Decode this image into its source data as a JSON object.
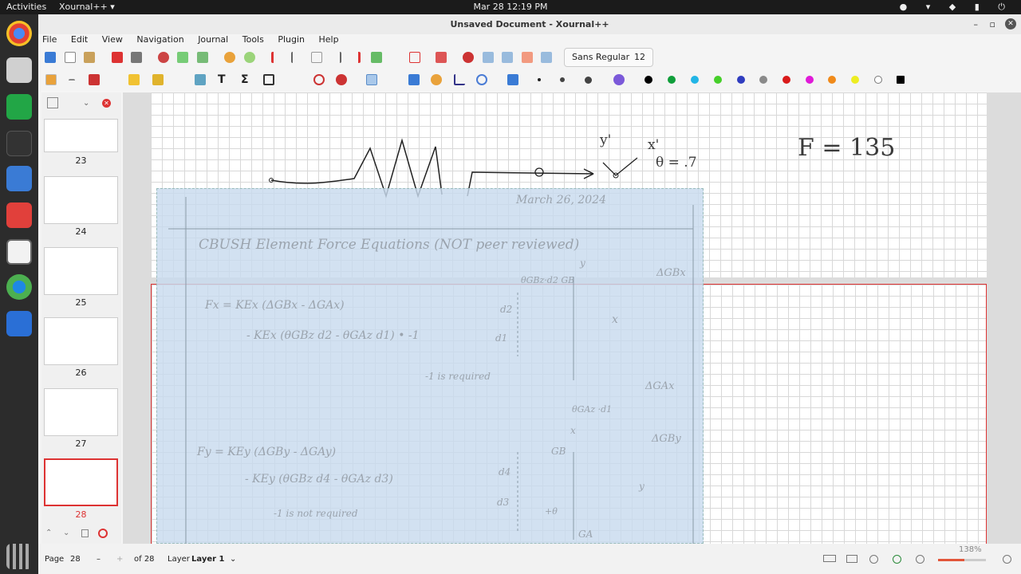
{
  "topbar": {
    "activities": "Activities",
    "app_name": "Xournal++ ▾",
    "clock": "Mar 28  12:19 PM"
  },
  "window": {
    "title": "Unsaved Document - Xournal++"
  },
  "menu": [
    "File",
    "Edit",
    "View",
    "Navigation",
    "Journal",
    "Tools",
    "Plugin",
    "Help"
  ],
  "toolbar": {
    "font_name": "Sans Regular",
    "font_size": "12",
    "colors": [
      "#000000",
      "#109e3a",
      "#22b5e6",
      "#46cf2a",
      "#2f3cbf",
      "#8a8a8a",
      "#d91a1a",
      "#e01ad8",
      "#f08a1a",
      "#eded22",
      "#ffffff",
      "#000000"
    ]
  },
  "sidebar": {
    "pages": [
      {
        "label": "23"
      },
      {
        "label": "24"
      },
      {
        "label": "25"
      },
      {
        "label": "26"
      },
      {
        "label": "27"
      },
      {
        "label": "28"
      }
    ]
  },
  "canvas": {
    "top_notes": {
      "y_prime": "y'",
      "x_prime": "x'",
      "theta": "θ = .7",
      "force": "F = 135"
    },
    "overlay": {
      "date": "March 26, 2024",
      "title": "CBUSH Element Force Equations (NOT peer reviewed)",
      "fx_line1": "Fx = KEx (ΔGBx - ΔGAx)",
      "fx_line2": "- KEx (θGBz d2 - θGAz d1) • -1",
      "fx_note": "-1 is required",
      "fy_line1": "Fy = KEy (ΔGBy - ΔGAy)",
      "fy_line2": "- KEy (θGBz d4 - θGAz d3)",
      "fy_note": "-1 is not required",
      "diag": {
        "theta_gb": "θGBz·d2  GB",
        "delta_gbx": "ΔGBx",
        "d2": "d2",
        "d1": "d1",
        "x1": "x",
        "y1": "y",
        "delta_gax": "ΔGAx",
        "theta_ga": "θGAz ·d1",
        "gb2": "GB",
        "delta_gby": "ΔGBy",
        "d4": "d4",
        "d3": "d3",
        "ga": "GA",
        "x2": "x",
        "y2": "y",
        "plus_theta": "+θ"
      }
    }
  },
  "status": {
    "page_label": "Page",
    "page_value": "28",
    "of_pages": "of 28",
    "layer_label": "Layer",
    "layer_value": "Layer 1",
    "zoom": "138%"
  }
}
